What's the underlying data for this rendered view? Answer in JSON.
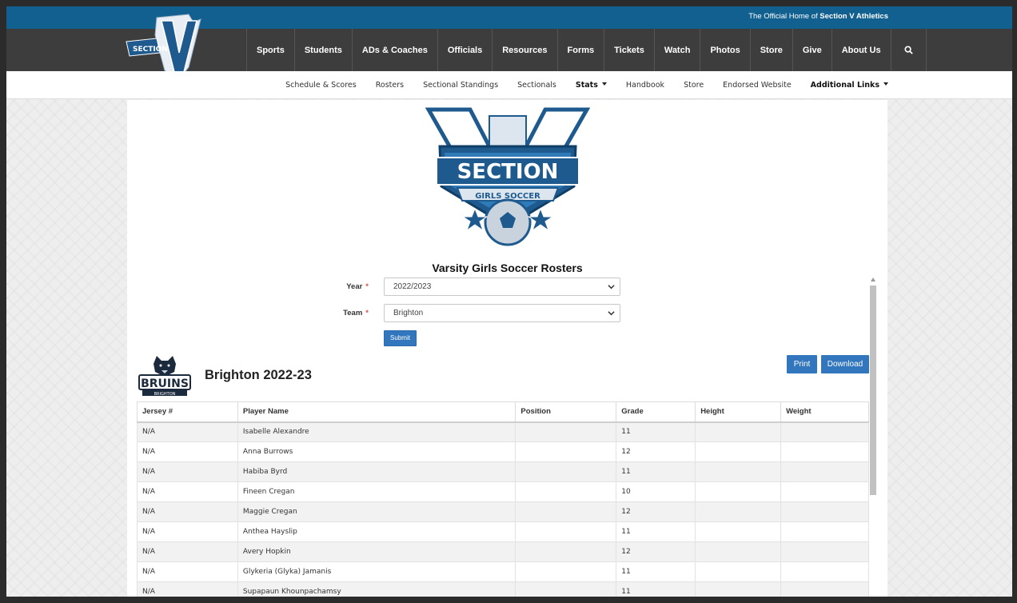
{
  "header": {
    "tagline_prefix": "The Official Home of",
    "tagline_org": "Section V Athletics",
    "logo_text": "SECTION",
    "logo_letter": "V"
  },
  "main_nav": [
    "Sports",
    "Students",
    "ADs & Coaches",
    "Officials",
    "Resources",
    "Forms",
    "Tickets",
    "Watch",
    "Photos",
    "Store",
    "Give",
    "About Us"
  ],
  "sub_nav": [
    {
      "label": "Schedule & Scores",
      "bold": false,
      "dropdown": false
    },
    {
      "label": "Rosters",
      "bold": false,
      "dropdown": false
    },
    {
      "label": "Sectional Standings",
      "bold": false,
      "dropdown": false
    },
    {
      "label": "Sectionals",
      "bold": false,
      "dropdown": false
    },
    {
      "label": "Stats",
      "bold": true,
      "dropdown": true
    },
    {
      "label": "Handbook",
      "bold": false,
      "dropdown": false
    },
    {
      "label": "Store",
      "bold": false,
      "dropdown": false
    },
    {
      "label": "Endorsed Website",
      "bold": false,
      "dropdown": false
    },
    {
      "label": "Additional Links",
      "bold": true,
      "dropdown": true
    }
  ],
  "crest": {
    "word": "SECTION",
    "sport": "GIRLS SOCCER"
  },
  "page": {
    "title": "Varsity Girls Soccer Rosters"
  },
  "form": {
    "year_label": "Year",
    "year_value": "2022/2023",
    "team_label": "Team",
    "team_value": "Brighton",
    "required_mark": "*",
    "submit_label": "Submit"
  },
  "roster": {
    "heading": "Brighton 2022-23",
    "team_logo_text": "BRUINS",
    "team_logo_subtext": "BRIGHTON",
    "print_label": "Print",
    "download_label": "Download",
    "columns": [
      "Jersey #",
      "Player Name",
      "Position",
      "Grade",
      "Height",
      "Weight"
    ],
    "rows": [
      [
        "N/A",
        "Isabelle Alexandre",
        "",
        "11",
        "",
        ""
      ],
      [
        "N/A",
        "Anna Burrows",
        "",
        "12",
        "",
        ""
      ],
      [
        "N/A",
        "Habiba Byrd",
        "",
        "11",
        "",
        ""
      ],
      [
        "N/A",
        "Fineen Cregan",
        "",
        "10",
        "",
        ""
      ],
      [
        "N/A",
        "Maggie Cregan",
        "",
        "12",
        "",
        ""
      ],
      [
        "N/A",
        "Anthea Hayslip",
        "",
        "11",
        "",
        ""
      ],
      [
        "N/A",
        "Avery Hopkin",
        "",
        "12",
        "",
        ""
      ],
      [
        "N/A",
        "Glykeria (Glyka) Jamanis",
        "",
        "11",
        "",
        ""
      ],
      [
        "N/A",
        "Supapaun Khounpachamsy",
        "",
        "11",
        "",
        ""
      ]
    ]
  },
  "colors": {
    "top_bar": "#12608f",
    "nav_bg": "#3d3d3d",
    "button": "#3277bd",
    "required": "#d9534f"
  }
}
